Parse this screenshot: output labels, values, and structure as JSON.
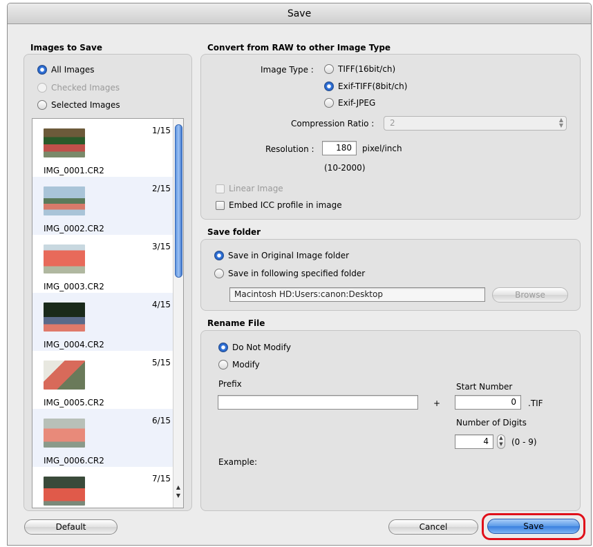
{
  "window": {
    "title": "Save"
  },
  "images_group": {
    "label": "Images to Save",
    "options": [
      {
        "label": "All Images",
        "selected": true,
        "disabled": false
      },
      {
        "label": "Checked Images",
        "selected": false,
        "disabled": true
      },
      {
        "label": "Selected Images",
        "selected": false,
        "disabled": false
      }
    ],
    "list": [
      {
        "count": "1/15",
        "file": "IMG_0001.CR2"
      },
      {
        "count": "2/15",
        "file": "IMG_0002.CR2"
      },
      {
        "count": "3/15",
        "file": "IMG_0003.CR2"
      },
      {
        "count": "4/15",
        "file": "IMG_0004.CR2"
      },
      {
        "count": "5/15",
        "file": "IMG_0005.CR2"
      },
      {
        "count": "6/15",
        "file": "IMG_0006.CR2"
      },
      {
        "count": "7/15",
        "file": ""
      }
    ]
  },
  "convert": {
    "label": "Convert from RAW to other Image Type",
    "image_type_label": "Image Type :",
    "types": [
      {
        "label": "TIFF(16bit/ch)",
        "selected": false
      },
      {
        "label": "Exif-TIFF(8bit/ch)",
        "selected": true
      },
      {
        "label": "Exif-JPEG",
        "selected": false
      }
    ],
    "compression_label": "Compression Ratio :",
    "compression_value": "2",
    "resolution_label": "Resolution :",
    "resolution_value": "180",
    "resolution_unit": "pixel/inch",
    "resolution_range": "(10-2000)",
    "linear_image": "Linear Image",
    "embed_icc": "Embed ICC profile in image"
  },
  "save_folder": {
    "label": "Save folder",
    "options": [
      {
        "label": "Save in Original Image folder",
        "selected": true
      },
      {
        "label": "Save in following specified folder",
        "selected": false
      }
    ],
    "path": "Macintosh HD:Users:canon:Desktop",
    "browse": "Browse"
  },
  "rename": {
    "label": "Rename File",
    "options": [
      {
        "label": "Do Not Modify",
        "selected": true
      },
      {
        "label": "Modify",
        "selected": false
      }
    ],
    "prefix_label": "Prefix",
    "prefix_value": "",
    "plus": "+",
    "start_number_label": "Start Number",
    "start_number_value": "0",
    "extension": ".TIF",
    "digits_label": "Number of Digits",
    "digits_value": "4",
    "digits_range": "(0 - 9)",
    "example_label": "Example:"
  },
  "buttons": {
    "default": "Default",
    "cancel": "Cancel",
    "save": "Save"
  },
  "colors": {
    "accent": "#3a7fdf",
    "highlight": "#e0101a"
  }
}
